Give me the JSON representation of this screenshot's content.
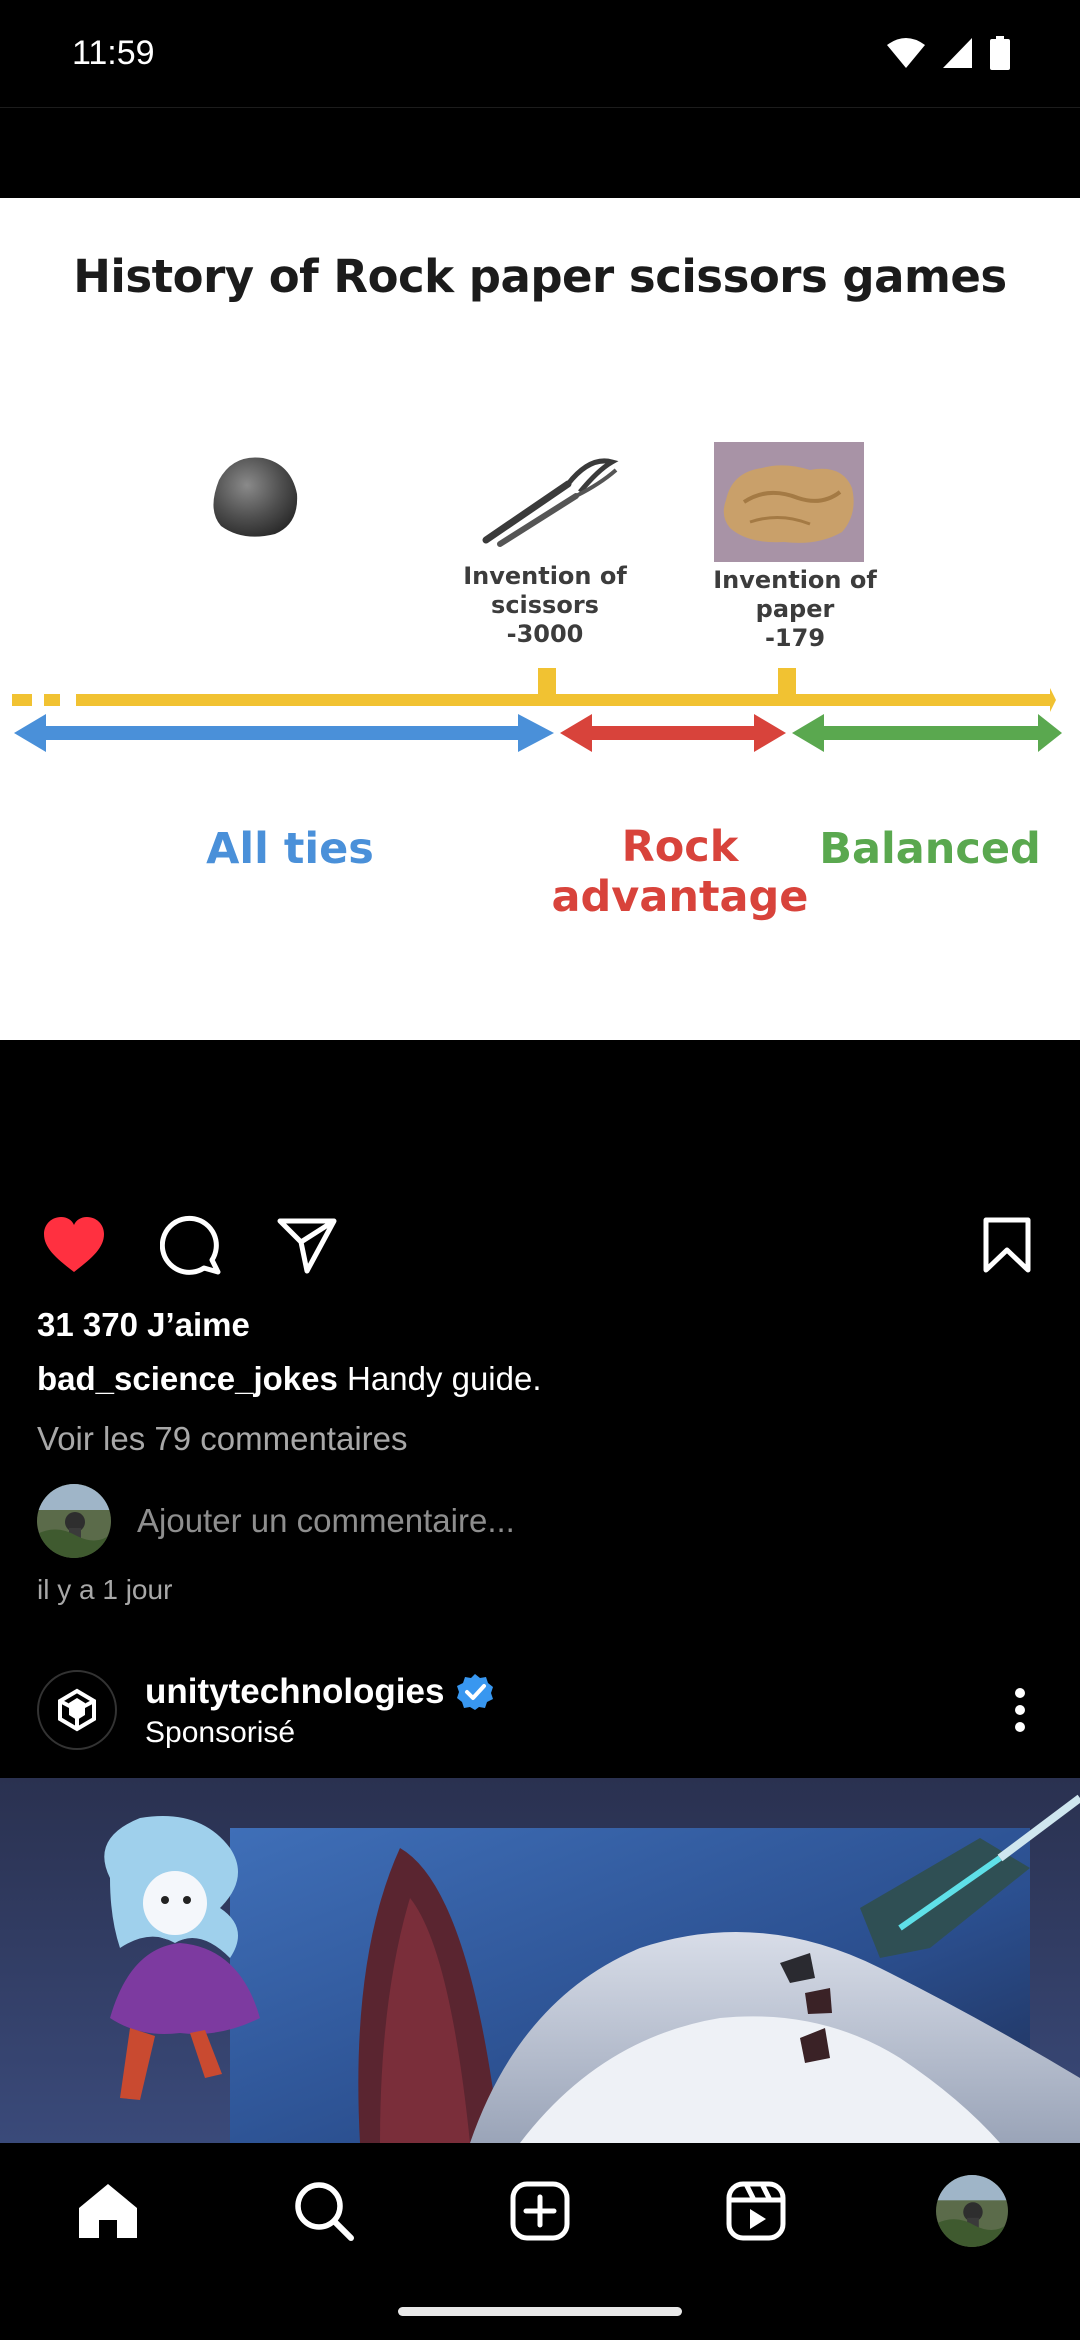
{
  "status_bar": {
    "time": "11:59",
    "icons": [
      "wifi-icon",
      "signal-icon",
      "battery-icon"
    ]
  },
  "post": {
    "image": {
      "title": "History of Rock paper scissors games",
      "inventions": [
        {
          "line1": "Invention of",
          "line2": "scissors",
          "line3": "-3000"
        },
        {
          "line1": "Invention of",
          "line2": "paper",
          "line3": "-179"
        }
      ],
      "eras": [
        {
          "line1": "All ties",
          "line2": "",
          "color": "#4a90d9"
        },
        {
          "line1": "Rock",
          "line2": "advantage",
          "color": "#d8433b"
        },
        {
          "line1": "Balanced",
          "line2": "",
          "color": "#5aa84f"
        }
      ],
      "timeline_color": "#f1c232"
    },
    "actions": [
      "like-icon",
      "comment-icon",
      "share-icon",
      "save-icon"
    ],
    "like_color": "#ff3040",
    "likes": "31 370 J’aime",
    "username": "bad_science_jokes",
    "caption": "Handy guide.",
    "view_comments": "Voir les 79 commentaires",
    "comment_placeholder": "Ajouter un commentaire...",
    "time_ago": "il y a 1 jour"
  },
  "sponsored": {
    "account": "unitytechnologies",
    "verified": true,
    "label": "Sponsorisé"
  },
  "bottom_nav": {
    "items": [
      "home-icon",
      "search-icon",
      "create-icon",
      "reels-icon",
      "profile-avatar"
    ]
  }
}
